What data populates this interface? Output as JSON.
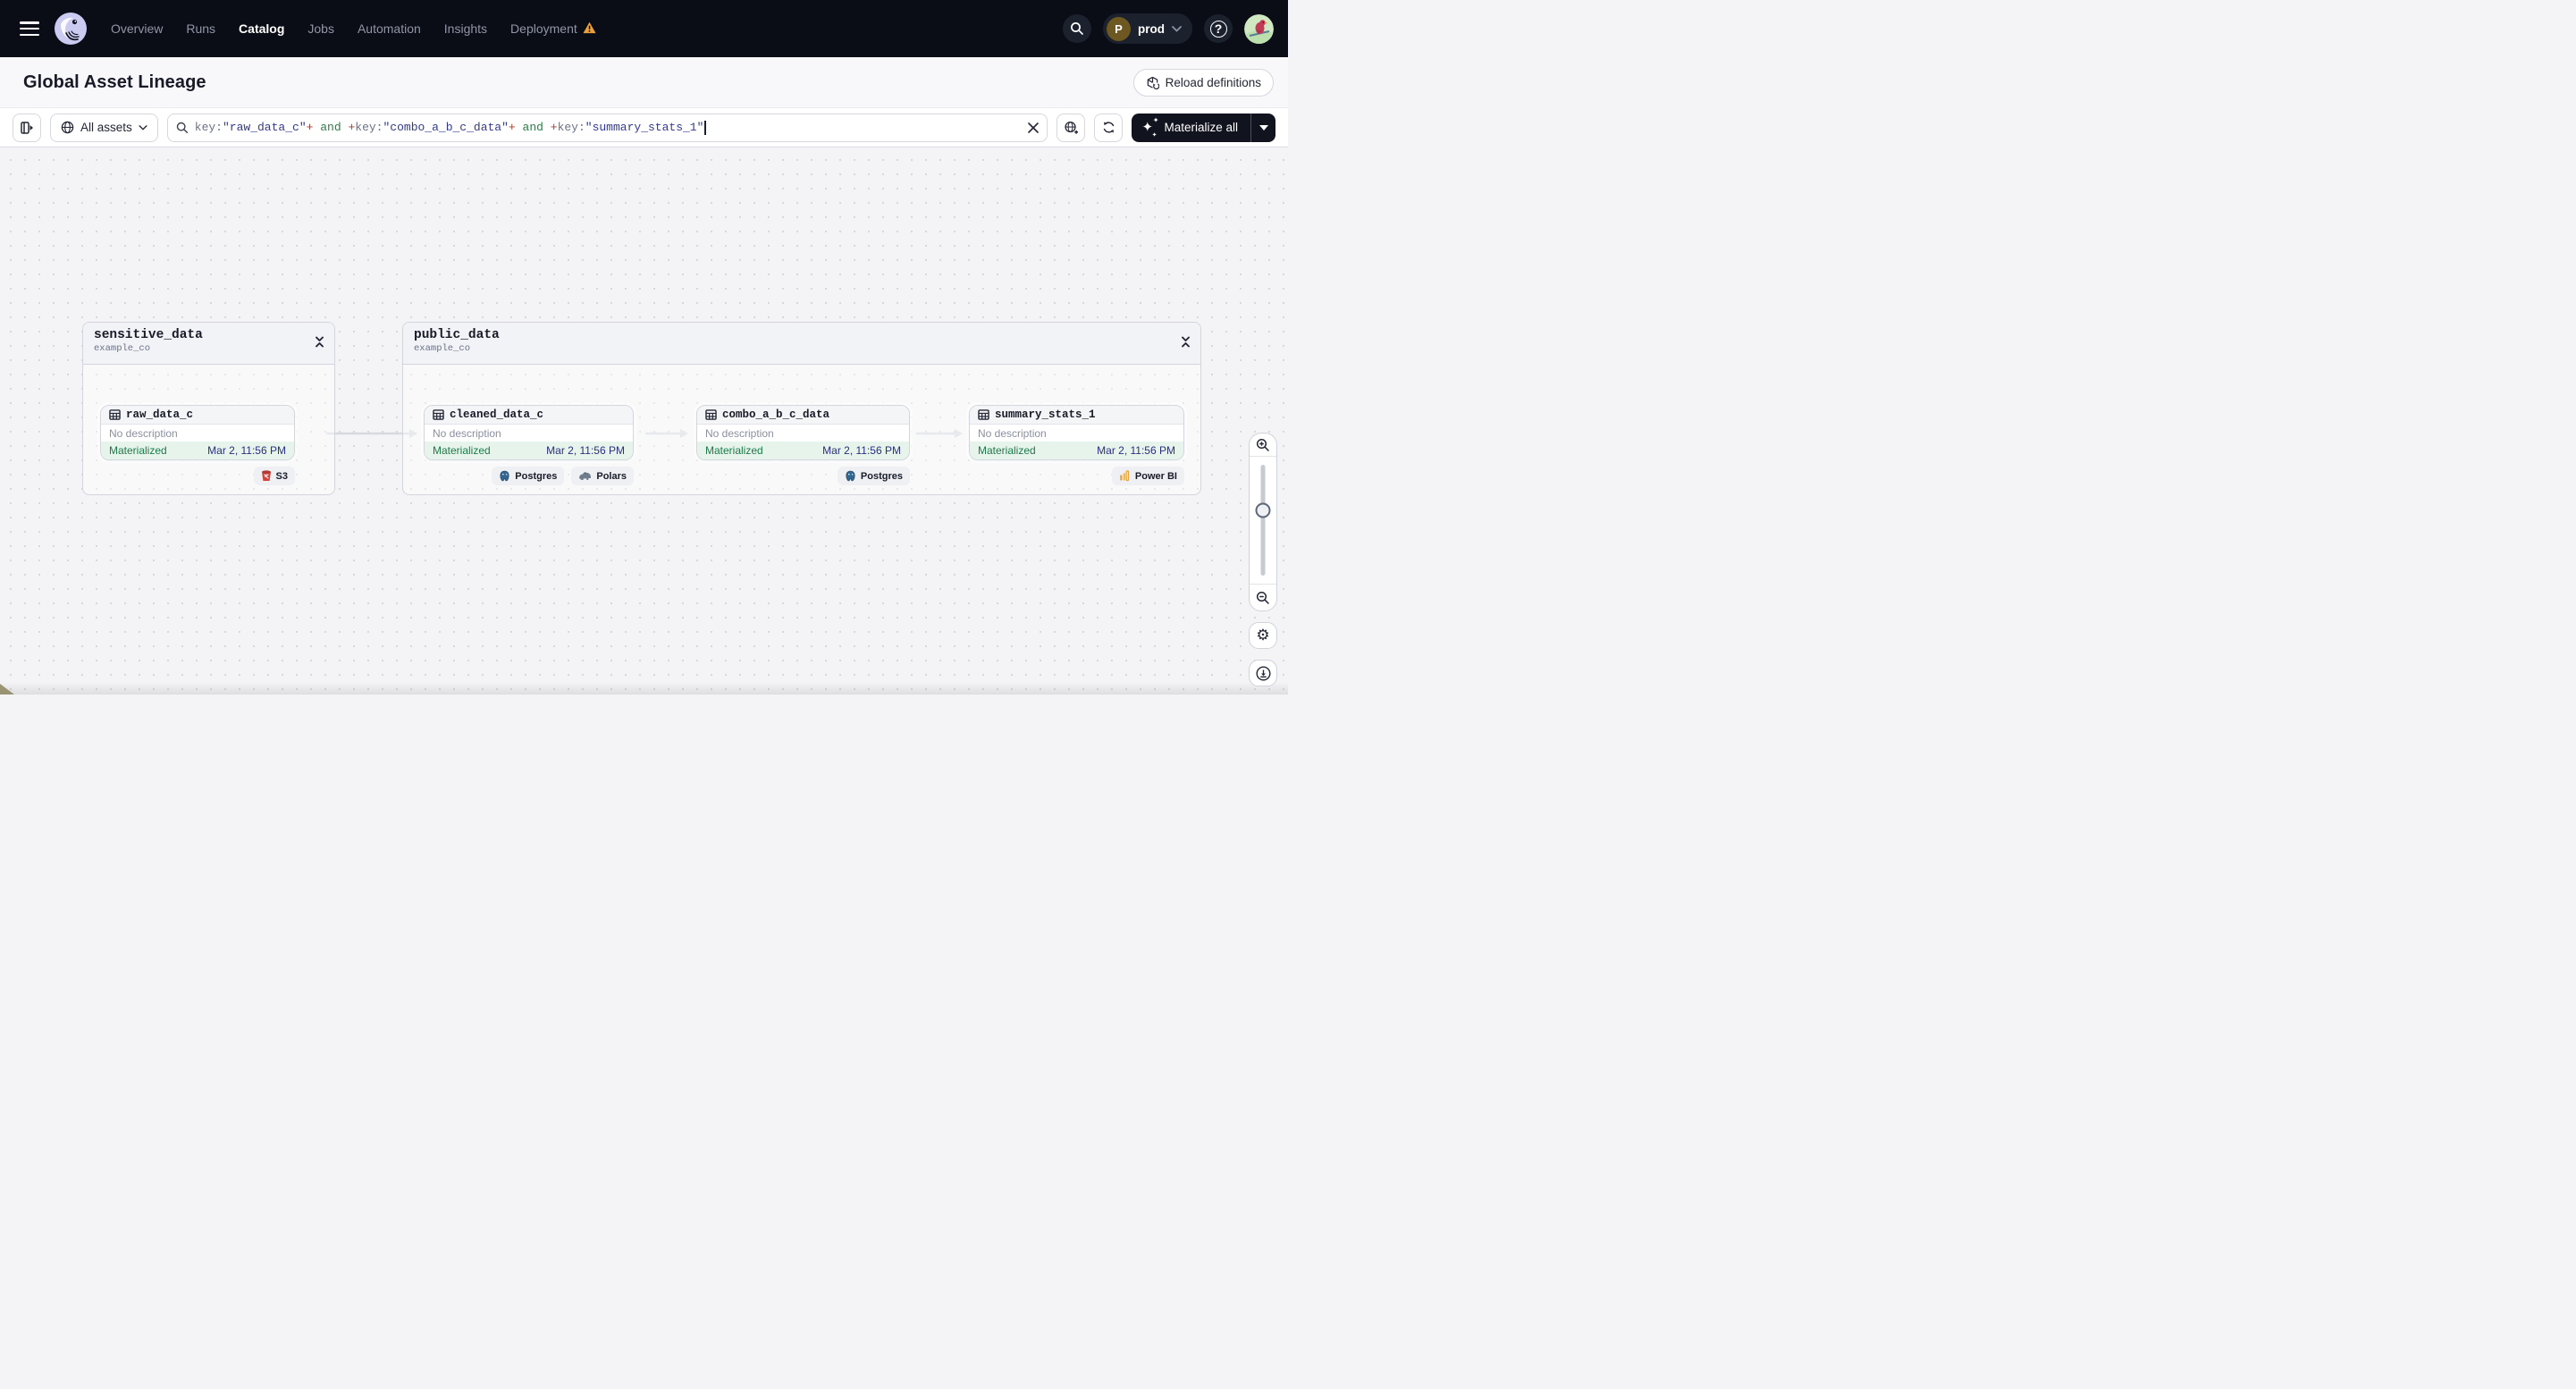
{
  "topnav": {
    "items": [
      {
        "label": "Overview",
        "active": false,
        "warning": false
      },
      {
        "label": "Runs",
        "active": false,
        "warning": false
      },
      {
        "label": "Catalog",
        "active": true,
        "warning": false
      },
      {
        "label": "Jobs",
        "active": false,
        "warning": false
      },
      {
        "label": "Automation",
        "active": false,
        "warning": false
      },
      {
        "label": "Insights",
        "active": false,
        "warning": false
      },
      {
        "label": "Deployment",
        "active": false,
        "warning": true
      }
    ],
    "environment": {
      "initial": "P",
      "name": "prod"
    }
  },
  "page": {
    "title": "Global Asset Lineage",
    "reload_button": "Reload definitions"
  },
  "toolbar": {
    "scope_button": "All assets",
    "search": {
      "segments": [
        {
          "text": "key:",
          "kind": "attr"
        },
        {
          "text": "\"raw_data_c\"",
          "kind": "value"
        },
        {
          "text": "+",
          "kind": "op"
        },
        {
          "text": " and ",
          "kind": "bool"
        },
        {
          "text": "+",
          "kind": "op"
        },
        {
          "text": "key:",
          "kind": "attr"
        },
        {
          "text": "\"combo_a_b_c_data\"",
          "kind": "value"
        },
        {
          "text": "+",
          "kind": "op"
        },
        {
          "text": " and ",
          "kind": "bool"
        },
        {
          "text": "+",
          "kind": "op"
        },
        {
          "text": "key:",
          "kind": "attr"
        },
        {
          "text": "\"summary_stats_1\"",
          "kind": "value"
        }
      ]
    },
    "materialize_button": "Materialize all"
  },
  "graph": {
    "groups": [
      {
        "name": "sensitive_data",
        "subtitle": "example_co",
        "assets": [
          {
            "name": "raw_data_c",
            "description": "No description",
            "status": "Materialized",
            "timestamp": "Mar 2, 11:56 PM",
            "tags": [
              {
                "label": "S3",
                "icon": "s3-icon"
              }
            ]
          }
        ]
      },
      {
        "name": "public_data",
        "subtitle": "example_co",
        "assets": [
          {
            "name": "cleaned_data_c",
            "description": "No description",
            "status": "Materialized",
            "timestamp": "Mar 2, 11:56 PM",
            "tags": [
              {
                "label": "Postgres",
                "icon": "postgres-icon"
              },
              {
                "label": "Polars",
                "icon": "polars-icon"
              }
            ]
          },
          {
            "name": "combo_a_b_c_data",
            "description": "No description",
            "status": "Materialized",
            "timestamp": "Mar 2, 11:56 PM",
            "tags": [
              {
                "label": "Postgres",
                "icon": "postgres-icon"
              }
            ]
          },
          {
            "name": "summary_stats_1",
            "description": "No description",
            "status": "Materialized",
            "timestamp": "Mar 2, 11:56 PM",
            "tags": [
              {
                "label": "Power BI",
                "icon": "powerbi-icon"
              }
            ]
          }
        ]
      }
    ]
  },
  "colors": {
    "topbar": "#0b0d16",
    "warning": "#eba03c",
    "status_green": "#1d7a48",
    "status_bg": "#e6f4ec",
    "timestamp_navy": "#2b2f7e",
    "token_attr": "#6a7386",
    "token_value": "#333a8f",
    "token_op": "#9c3f36",
    "token_bool": "#2e7d46",
    "dark_button": "#11141f",
    "edge_gray": "#d7d9df"
  }
}
